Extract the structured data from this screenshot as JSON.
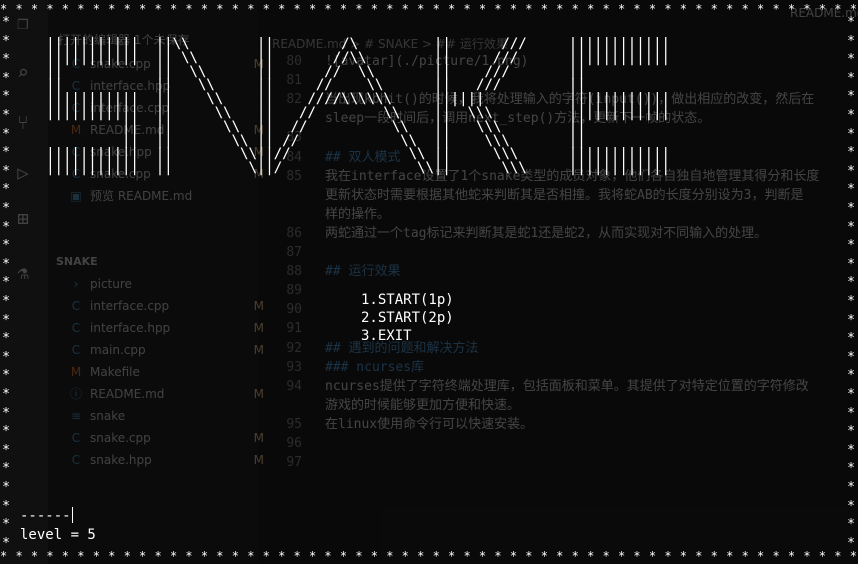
{
  "editor": {
    "tab_label": "README.md",
    "breadcrumb": "README.md > # SNAKE > ## 运行效果",
    "sidebar": {
      "header_label": "打开的编辑器 1个未保存",
      "open_items": [
        {
          "icon": "C",
          "name": "snake.cpp",
          "badge": "M"
        },
        {
          "icon": "C",
          "name": "interface.hpp",
          "badge": ""
        },
        {
          "icon": "C",
          "name": "interface.cpp",
          "badge": ""
        },
        {
          "icon": "M",
          "name": "README.md",
          "badge": "M"
        },
        {
          "icon": "C",
          "name": "snake.hpp",
          "badge": "M"
        },
        {
          "icon": "C",
          "name": "snake.cpp",
          "badge": "M"
        },
        {
          "icon": "▣",
          "name": "预览 README.md",
          "badge": ""
        }
      ],
      "folder_label": "SNAKE",
      "folder_items": [
        {
          "icon": "›",
          "name": "picture",
          "badge": ""
        },
        {
          "icon": "C",
          "name": "interface.cpp",
          "badge": "M"
        },
        {
          "icon": "C",
          "name": "interface.hpp",
          "badge": "M"
        },
        {
          "icon": "C",
          "name": "main.cpp",
          "badge": "M"
        },
        {
          "icon": "M",
          "name": "Makefile",
          "badge": ""
        },
        {
          "icon": "ⓘ",
          "name": "README.md",
          "badge": "M"
        },
        {
          "icon": "≡",
          "name": "snake",
          "badge": ""
        },
        {
          "icon": "C",
          "name": "snake.cpp",
          "badge": "M"
        },
        {
          "icon": "C",
          "name": "snake.hpp",
          "badge": "M"
        }
      ]
    },
    "code_lines": [
      {
        "num": "80",
        "text": "![avatar](./picture/1.png)",
        "heading": false
      },
      {
        "num": "81",
        "text": "",
        "heading": false
      },
      {
        "num": "82",
        "text": "当出现kbhit()的时候，我将处理输入的字符(input())，做出相应的改变，然后在",
        "heading": false
      },
      {
        "num": "",
        "text": "sleep一段时间后，调用next_step()方法，更新下一帧的状态。",
        "heading": false
      },
      {
        "num": "83",
        "text": "",
        "heading": false
      },
      {
        "num": "84",
        "text": "## 双人模式",
        "heading": true
      },
      {
        "num": "85",
        "text": "我在interface设置了1个snake类型的成员对象，他们各自独自地管理其得分和长度",
        "heading": false
      },
      {
        "num": "",
        "text": "更新状态时需要根据其他蛇来判断其是否相撞。我将蛇AB的长度分别设为3，判断是",
        "heading": false
      },
      {
        "num": "",
        "text": "样的操作。",
        "heading": false
      },
      {
        "num": "86",
        "text": "两蛇通过一个tag标记来判断其是蛇1还是蛇2，从而实现对不同输入的处理。",
        "heading": false
      },
      {
        "num": "87",
        "text": "",
        "heading": false
      },
      {
        "num": "88",
        "text": "## 运行效果",
        "heading": true
      },
      {
        "num": "89",
        "text": "",
        "heading": false
      },
      {
        "num": "90",
        "text": "",
        "heading": false
      },
      {
        "num": "91",
        "text": "",
        "heading": false
      },
      {
        "num": "92",
        "text": "## 遇到的问题和解决方法",
        "heading": true
      },
      {
        "num": "93",
        "text": "### ncurses库",
        "heading": true
      },
      {
        "num": "94",
        "text": "ncurses提供了字符终端处理库，包括面板和菜单。其提供了对特定位置的字符修改",
        "heading": false
      },
      {
        "num": "",
        "text": "游戏的时候能够更加方便和快速。",
        "heading": false
      },
      {
        "num": "95",
        "text": "在linux使用命令行可以快速安装。",
        "heading": false
      },
      {
        "num": "96",
        "text": "",
        "heading": false
      },
      {
        "num": "97",
        "text": "",
        "heading": false
      }
    ]
  },
  "terminal": {
    "logo": "|||||||||||  ||\\\\        ||        /\\         ||      ///     ||||||||||||\n|||||||||||  || \\\\       ||       //\\\\        ||     ///      ||||||||||||\n||           ||  \\\\      ||      //  \\\\       ||    ///       ||\n||           ||   \\\\     ||     //    \\\\      ||   ///        ||\n|||||||||||  ||    \\\\    ||    ////\\\\\\\\\\\\     ||||||          ||||||||||||\n|||||||||||  ||     \\\\   ||   //        \\\\    ||  \\\\\\         ||||||||||||\n         ||  ||      \\\\  ||  //          \\\\   ||   \\\\\\        ||\n         ||  ||       \\\\ || //            \\\\  ||    \\\\\\       ||\n|||||||||||  ||        \\\\||//              \\\\ ||     \\\\\\      ||||||||||||\n|||||||||||  ||         \\||/                \\\\||      \\\\\\     ||||||||||||",
    "menu": [
      {
        "label": "1.START(1p)"
      },
      {
        "label": "2.START(2p)"
      },
      {
        "label": "3.EXIT"
      }
    ],
    "input_text": "------",
    "level_text": "level = 5",
    "border_char": "*"
  }
}
